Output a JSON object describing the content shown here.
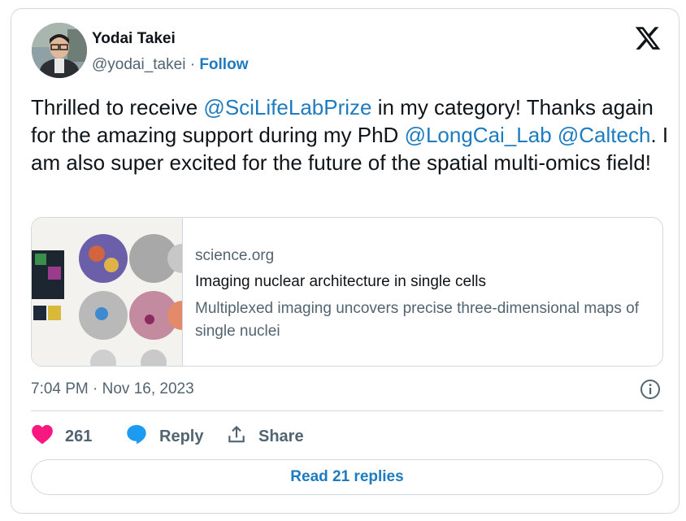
{
  "author": {
    "name": "Yodai Takei",
    "handle": "@yodai_takei",
    "separator": " · ",
    "follow_label": "Follow"
  },
  "tweet": {
    "segments": [
      {
        "text": "Thrilled to receive ",
        "mention": false
      },
      {
        "text": "@SciLifeLabPrize",
        "mention": true
      },
      {
        "text": " in my category! Thanks again for the amazing support during my PhD ",
        "mention": false
      },
      {
        "text": "@LongCai_Lab",
        "mention": true
      },
      {
        "text": " ",
        "mention": false
      },
      {
        "text": "@Caltech",
        "mention": true
      },
      {
        "text": ". I am also super excited for the future of the spatial multi-omics field!",
        "mention": false
      }
    ]
  },
  "link_card": {
    "domain": "science.org",
    "title": "Imaging nuclear architecture in single cells",
    "description": "Multiplexed imaging uncovers precise three-dimensional maps of single nuclei"
  },
  "timestamp": "7:04 PM · Nov 16, 2023",
  "actions": {
    "likes": "261",
    "reply_label": "Reply",
    "share_label": "Share"
  },
  "read_replies_label": "Read 21 replies",
  "colors": {
    "accent": "#1d7bbf",
    "heart": "#f91880",
    "secondary_text": "#536471",
    "border": "#cfd9de"
  },
  "icons": [
    "x-logo-icon",
    "info-icon",
    "heart-icon",
    "reply-icon",
    "share-icon"
  ]
}
